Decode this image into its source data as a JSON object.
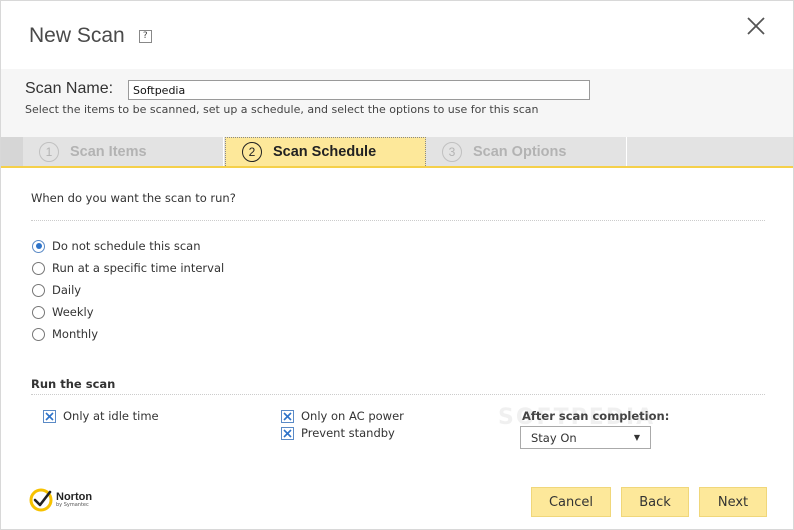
{
  "window": {
    "title": "New Scan",
    "help": "?"
  },
  "scan_name": {
    "label": "Scan Name:",
    "value": "Softpedia",
    "hint": "Select the items to be scanned, set up a schedule, and select the options to use for this scan"
  },
  "tabs": [
    {
      "num": "1",
      "label": "Scan Items",
      "active": false
    },
    {
      "num": "2",
      "label": "Scan Schedule",
      "active": true
    },
    {
      "num": "3",
      "label": "Scan Options",
      "active": false
    }
  ],
  "schedule": {
    "question": "When do you want the scan to run?",
    "options": [
      {
        "label": "Do not schedule this scan",
        "selected": true
      },
      {
        "label": "Run at a specific time interval",
        "selected": false
      },
      {
        "label": "Daily",
        "selected": false
      },
      {
        "label": "Weekly",
        "selected": false
      },
      {
        "label": "Monthly",
        "selected": false
      }
    ]
  },
  "run_the_scan": {
    "title": "Run the scan",
    "idle_only": {
      "label": "Only at idle time",
      "checked": true
    },
    "ac_power": {
      "label": "Only on AC power",
      "checked": true
    },
    "prevent_standby": {
      "label": "Prevent standby",
      "checked": true
    },
    "after_completion": {
      "label": "After scan completion:",
      "value": "Stay On"
    }
  },
  "watermark": "SOFTPEDIA",
  "brand": {
    "name": "Norton",
    "sub": "by Symantec",
    "check_color": "#f7c200"
  },
  "buttons": {
    "cancel": "Cancel",
    "back": "Back",
    "next": "Next"
  },
  "colors": {
    "accent": "#fde89a",
    "tab_border": "#f5d04a",
    "check_mark": "#2e73c9"
  }
}
